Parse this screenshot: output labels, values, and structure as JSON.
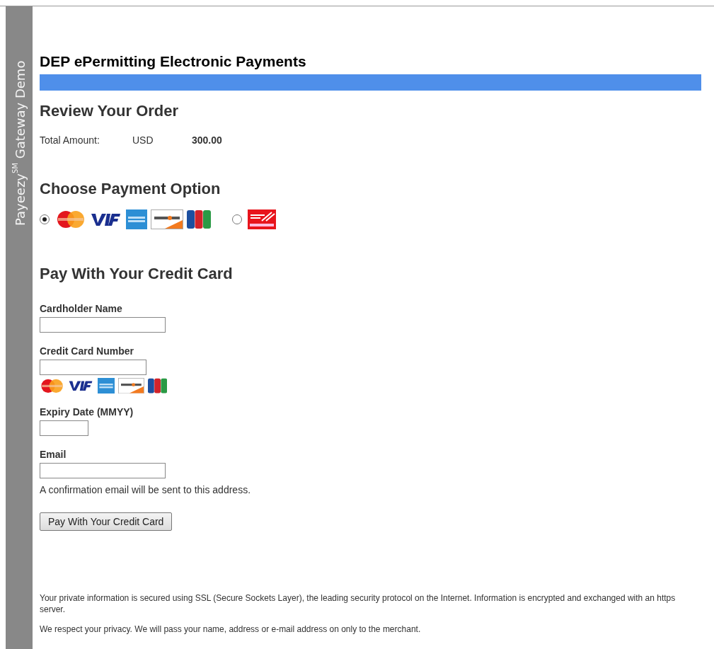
{
  "sidebar": {
    "title": "Payeezy$^{SM}$ Gateway Demo"
  },
  "page_title": "DEP ePermitting Electronic Payments",
  "review": {
    "heading": "Review Your Order",
    "label": "Total Amount:",
    "currency": "USD",
    "amount": "300.00"
  },
  "payment_options": {
    "heading": "Choose Payment Option",
    "options": [
      {
        "kind": "cards",
        "selected": true
      },
      {
        "kind": "check",
        "selected": false
      }
    ]
  },
  "credit_card": {
    "heading": "Pay With Your Credit Card",
    "fields": [
      {
        "kind": "text",
        "label": "Cardholder Name"
      },
      {
        "kind": "card",
        "label": "Credit Card Number"
      },
      {
        "kind": "text",
        "label": "Expiry Date (MMYY)"
      },
      {
        "kind": "email",
        "label": "Email",
        "note": "A confirmation email will be sent to this address."
      }
    ],
    "button": "Pay With Your Credit Card"
  },
  "footer": [
    "Your private information is secured using SSL (Secure Sockets Layer), the leading security protocol on the Internet. Information is encrypted and exchanged with an https server.",
    "We respect your privacy. We will pass your name, address or e-mail address on only to the merchant."
  ]
}
